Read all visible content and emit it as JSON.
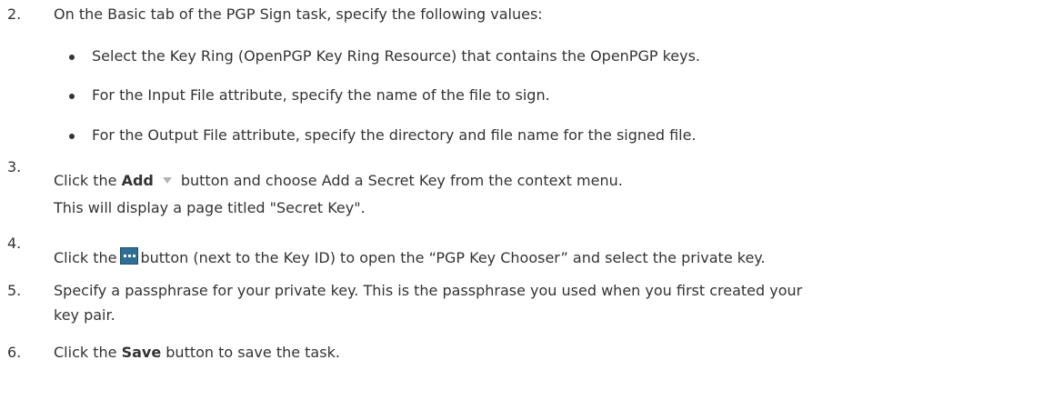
{
  "steps": [
    {
      "number": "2.",
      "text": "On the Basic tab of the PGP Sign task, specify the following values:",
      "bullets": [
        "Select the Key Ring (OpenPGP Key Ring Resource) that contains the OpenPGP keys.",
        "For the Input File attribute, specify the name of the file to sign.",
        "For the Output File attribute, specify the directory and file name for the signed file."
      ]
    },
    {
      "number": "3.",
      "text_before": "Click the",
      "bold": "Add",
      "icon": "dropdown-caret-icon",
      "text_after": "button and choose Add a Secret Key from the context menu.",
      "line2": "This will display a page titled \"Secret Key\"."
    },
    {
      "number": "4.",
      "text_before": "Click the",
      "icon": "ellipsis-browse-icon",
      "text_after": "button (next to the Key ID) to open the “PGP Key Chooser” and select the private key."
    },
    {
      "number": "5.",
      "line1": "Specify a passphrase for your private key.  This is the passphrase you used when you first created your",
      "line2": "key pair."
    },
    {
      "number": "6.",
      "text_before": "Click the",
      "bold": "Save",
      "text_after": "button to save the task."
    }
  ]
}
